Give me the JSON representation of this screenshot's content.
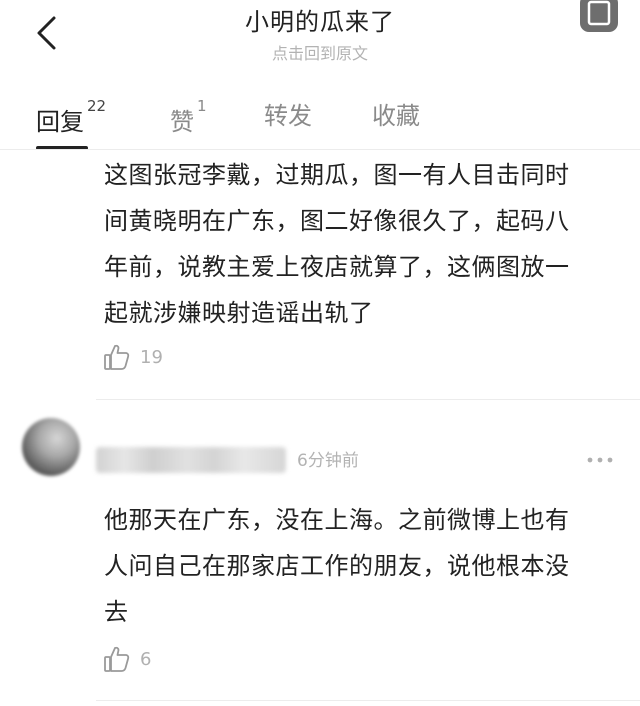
{
  "header": {
    "title": "小明的瓜来了",
    "subtitle": "点击回到原文"
  },
  "tabs": [
    {
      "label": "回复",
      "count": "22",
      "active": true
    },
    {
      "label": "赞",
      "count": "1",
      "active": false
    },
    {
      "label": "转发",
      "count": "",
      "active": false
    },
    {
      "label": "收藏",
      "count": "",
      "active": false
    }
  ],
  "comments": [
    {
      "lines": [
        "这图张冠李戴，过期瓜，图一有人目击同时",
        "间黄晓明在广东，图二好像很久了，起码八",
        "年前，说教主爱上夜店就算了，这俩图放一",
        "起就涉嫌映射造谣出轨了"
      ],
      "likes": "19"
    },
    {
      "time": "6分钟前",
      "lines": [
        "他那天在广东，没在上海。之前微博上也有",
        "人问自己在那家店工作的朋友，说他根本没",
        "去"
      ],
      "likes": "6"
    }
  ],
  "icons": {
    "back": "back-arrow-icon",
    "share": "share-icon",
    "like": "thumbs-up-icon",
    "more": "more-dots-icon"
  },
  "colors": {
    "text": "#222222",
    "muted": "#b3b3b3",
    "divider": "#ececec"
  }
}
